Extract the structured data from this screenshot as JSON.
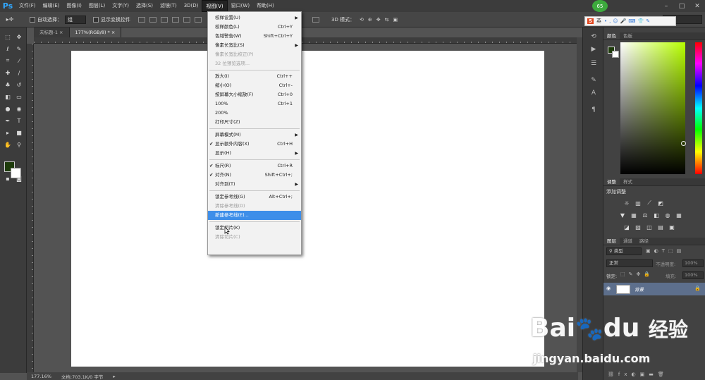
{
  "app": {
    "logo": "Ps"
  },
  "menubar": {
    "items": [
      "文件(F)",
      "编辑(E)",
      "图像(I)",
      "图层(L)",
      "文字(Y)",
      "选择(S)",
      "滤镜(T)",
      "3D(D)",
      "视图(V)",
      "窗口(W)",
      "帮助(H)"
    ],
    "active_index": 8
  },
  "window_controls": {
    "minimize": "–",
    "restore": "□",
    "close": "✕"
  },
  "options_bar": {
    "auto_select_label": "自动选择：",
    "auto_select_value": "组",
    "show_transform_label": "显示变换控件",
    "mode_3d_label": "3D 模式："
  },
  "tabs": [
    {
      "label": "未标题-1"
    },
    {
      "label": "177%(RGB/8) *"
    }
  ],
  "view_menu": {
    "items": [
      {
        "label": "校样设置(U)",
        "shortcut": "",
        "submenu": true,
        "checked": false,
        "disabled": false
      },
      {
        "label": "校样颜色(L)",
        "shortcut": "Ctrl+Y",
        "submenu": false,
        "checked": false,
        "disabled": false
      },
      {
        "label": "色域警告(W)",
        "shortcut": "Shift+Ctrl+Y",
        "submenu": false,
        "checked": false,
        "disabled": false
      },
      {
        "label": "像素长宽比(S)",
        "shortcut": "",
        "submenu": true,
        "checked": false,
        "disabled": false
      },
      {
        "label": "像素长宽比校正(P)",
        "shortcut": "",
        "submenu": false,
        "checked": false,
        "disabled": true
      },
      {
        "label": "32 位预览选项...",
        "shortcut": "",
        "submenu": false,
        "checked": false,
        "disabled": true
      },
      {
        "label": "放大(I)",
        "shortcut": "Ctrl++",
        "submenu": false,
        "checked": false,
        "disabled": false
      },
      {
        "label": "缩小(O)",
        "shortcut": "Ctrl+-",
        "submenu": false,
        "checked": false,
        "disabled": false
      },
      {
        "label": "按屏幕大小缩放(F)",
        "shortcut": "Ctrl+0",
        "submenu": false,
        "checked": false,
        "disabled": false
      },
      {
        "label": "100%",
        "shortcut": "Ctrl+1",
        "submenu": false,
        "checked": false,
        "disabled": false
      },
      {
        "label": "200%",
        "shortcut": "",
        "submenu": false,
        "checked": false,
        "disabled": false
      },
      {
        "label": "打印尺寸(Z)",
        "shortcut": "",
        "submenu": false,
        "checked": false,
        "disabled": false
      },
      {
        "label": "屏幕模式(M)",
        "shortcut": "",
        "submenu": true,
        "checked": false,
        "disabled": false
      },
      {
        "label": "显示额外内容(X)",
        "shortcut": "Ctrl+H",
        "submenu": false,
        "checked": true,
        "disabled": false
      },
      {
        "label": "显示(H)",
        "shortcut": "",
        "submenu": true,
        "checked": false,
        "disabled": false
      },
      {
        "label": "标尺(R)",
        "shortcut": "Ctrl+R",
        "submenu": false,
        "checked": true,
        "disabled": false
      },
      {
        "label": "对齐(N)",
        "shortcut": "Shift+Ctrl+;",
        "submenu": false,
        "checked": true,
        "disabled": false
      },
      {
        "label": "对齐到(T)",
        "shortcut": "",
        "submenu": true,
        "checked": false,
        "disabled": false
      },
      {
        "label": "锁定参考线(G)",
        "shortcut": "Alt+Ctrl+;",
        "submenu": false,
        "checked": false,
        "disabled": false
      },
      {
        "label": "清除参考线(D)",
        "shortcut": "",
        "submenu": false,
        "checked": false,
        "disabled": true
      },
      {
        "label": "新建参考线(E)...",
        "shortcut": "",
        "submenu": false,
        "checked": false,
        "disabled": false,
        "highlighted": true
      },
      {
        "label": "锁定切片(K)",
        "shortcut": "",
        "submenu": false,
        "checked": false,
        "disabled": false
      },
      {
        "label": "清除切片(C)",
        "shortcut": "",
        "submenu": false,
        "checked": false,
        "disabled": true
      }
    ]
  },
  "status": {
    "zoom": "177.16%",
    "doc": "文档:703.1K/0 字节"
  },
  "color_panel": {
    "tabs": [
      "颜色",
      "色板"
    ],
    "fg_color": "#1e3b0b",
    "bg_color": "#ffffff"
  },
  "adjust_panel": {
    "tabs": [
      "调整",
      "样式"
    ],
    "title": "添加调整"
  },
  "layers_panel": {
    "tabs": [
      "图层",
      "通道",
      "路径"
    ],
    "filter": "类型",
    "blend_mode": "正常",
    "opacity_label": "不透明度:",
    "opacity_value": "100%",
    "lock_label": "锁定:",
    "fill_label": "填充:",
    "fill_value": "100%",
    "layers": [
      {
        "name": "背景"
      }
    ]
  },
  "ime_toolbar": {
    "lang": "英"
  },
  "badge": {
    "text": "65"
  },
  "watermark": {
    "brand": "Bai",
    "brand2": "du",
    "cn": "经验",
    "url": "jingyan.baidu.com"
  }
}
